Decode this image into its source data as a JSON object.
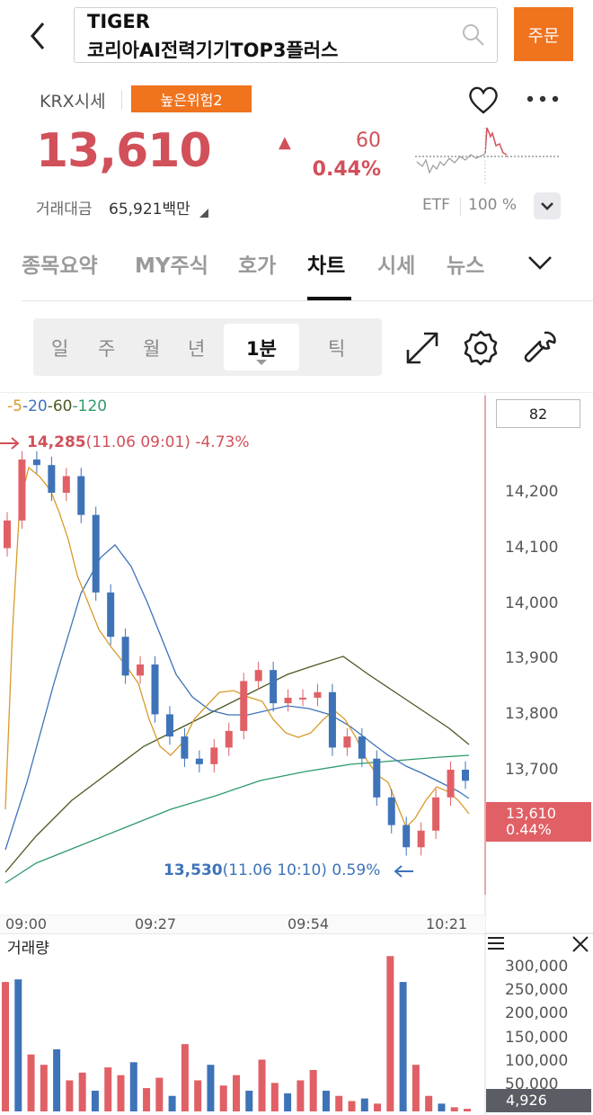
{
  "header": {
    "title_line1": "TIGER",
    "title_line2": "코리아AI전력기기TOP3플러스",
    "order_button": "주문"
  },
  "quote": {
    "market": "KRX시세",
    "risk_badge": "높은위험2",
    "price": "13,610",
    "change_arrow": "▲",
    "change": "60",
    "change_percent": "0.44%",
    "volume_amount_label": "거래대금",
    "volume_amount": "65,921백만",
    "etf_label": "ETF",
    "etf_value": "100 %"
  },
  "tabs": [
    {
      "label": "종목요약",
      "active": false
    },
    {
      "label": "MY주식",
      "active": false
    },
    {
      "label": "호가",
      "active": false
    },
    {
      "label": "차트",
      "active": true
    },
    {
      "label": "시세",
      "active": false
    },
    {
      "label": "뉴스",
      "active": false
    }
  ],
  "periods": [
    "일",
    "주",
    "월",
    "년",
    "1분",
    "틱"
  ],
  "active_period": "1분",
  "chart": {
    "ma_legend": [
      {
        "text": "-5",
        "color": "#d99a2b"
      },
      {
        "text": "-20",
        "color": "#3e73b8"
      },
      {
        "text": "-60",
        "color": "#4a5a22"
      },
      {
        "text": "-120",
        "color": "#2e9a6a"
      }
    ],
    "max_value": "14,285",
    "max_detail": "(11.06 09:01) -4.73%",
    "min_value": "13,530",
    "min_detail": "(11.06 10:10) 0.59%",
    "value_box": "82",
    "last_price": "13,610",
    "last_change": "0.44%",
    "y_ticks": [
      "14,200",
      "14,100",
      "14,000",
      "13,900",
      "13,800",
      "13,700"
    ],
    "x_ticks": [
      "09:00",
      "09:27",
      "09:54",
      "10:21"
    ],
    "volume_title": "거래량",
    "volume_ticks": [
      "300,000",
      "250,000",
      "200,000",
      "150,000",
      "100,000",
      "50,000"
    ],
    "volume_last": "4,926"
  },
  "chart_data": {
    "type": "candlestick",
    "interval": "1 minute",
    "x": [
      "09:00",
      "09:27",
      "09:54",
      "10:21"
    ],
    "ylim": [
      13500,
      14300
    ],
    "series": [
      {
        "name": "5",
        "color": "#d99a2b"
      },
      {
        "name": "20",
        "color": "#3e73b8"
      },
      {
        "name": "60",
        "color": "#4a5a22"
      },
      {
        "name": "120",
        "color": "#2e9a6a"
      }
    ],
    "max": {
      "value": 14285,
      "time": "11.06 09:01",
      "pct": "-4.73%"
    },
    "min": {
      "value": 13530,
      "time": "11.06 10:10",
      "pct": "0.59%"
    },
    "last": {
      "value": 13610,
      "pct": "0.44%"
    },
    "candles_approx_close": [
      14150,
      14260,
      14250,
      14200,
      14230,
      14160,
      14020,
      13940,
      13870,
      13890,
      13800,
      13760,
      13720,
      13710,
      13740,
      13770,
      13860,
      13880,
      13820,
      13830,
      13830,
      13840,
      13740,
      13760,
      13720,
      13650,
      13600,
      13560,
      13590,
      13650,
      13700,
      13680
    ],
    "volume": {
      "ylim": [
        0,
        330000
      ],
      "last": 4926,
      "peak": 300000
    }
  },
  "icons": {
    "back": "chevron-left-icon",
    "search": "search-icon",
    "favorite": "heart-icon",
    "more": "more-icon",
    "fullscreen": "expand-arrows-icon",
    "settings": "gear-icon",
    "tools": "wrench-icon"
  }
}
